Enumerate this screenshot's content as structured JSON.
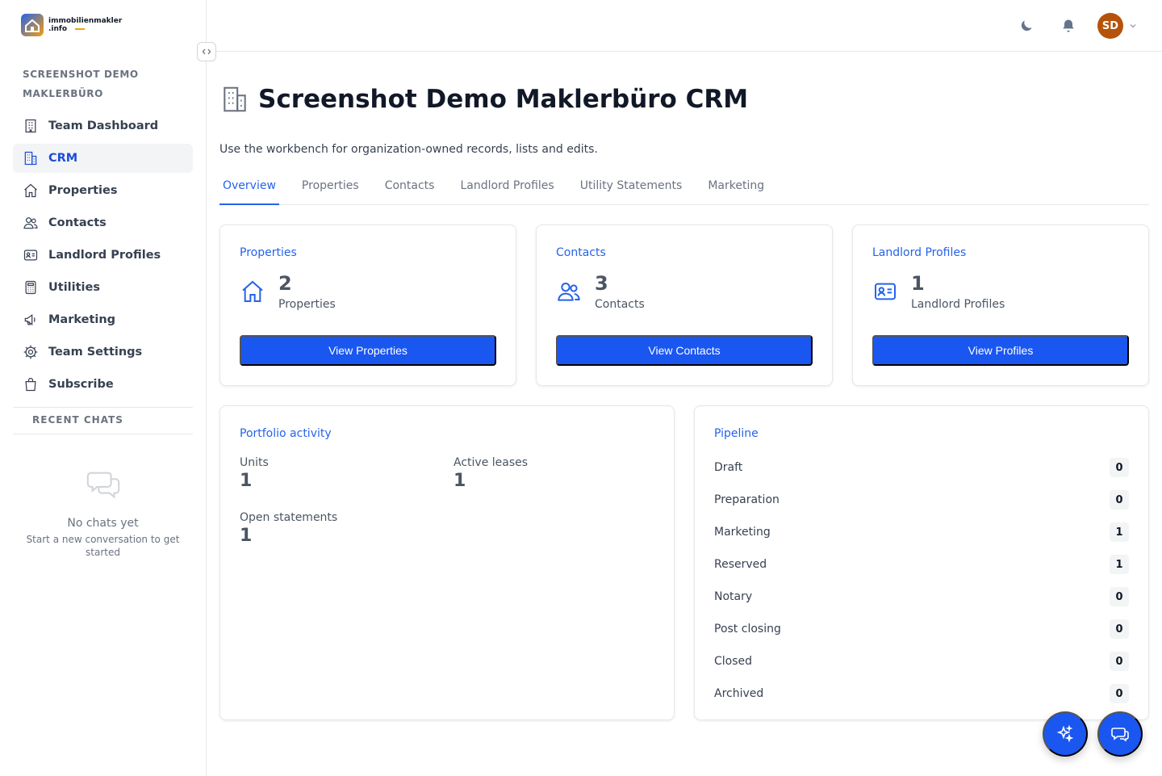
{
  "brand": {
    "line1": "immobilienmakler",
    "line2": ".info"
  },
  "sidebar": {
    "org_name": "SCREENSHOT DEMO MAKLERBÜRO",
    "items": [
      {
        "label": "Team Dashboard",
        "icon": "building-icon"
      },
      {
        "label": "CRM",
        "icon": "office-icon",
        "active": true
      },
      {
        "label": "Properties",
        "icon": "home-icon"
      },
      {
        "label": "Contacts",
        "icon": "users-icon"
      },
      {
        "label": "Landlord Profiles",
        "icon": "id-card-icon"
      },
      {
        "label": "Utilities",
        "icon": "calculator-icon"
      },
      {
        "label": "Marketing",
        "icon": "megaphone-icon"
      },
      {
        "label": "Team Settings",
        "icon": "cog-icon"
      },
      {
        "label": "Subscribe",
        "icon": "shopping-bag-icon"
      }
    ],
    "recent_chats_title": "RECENT CHATS",
    "no_chats_title": "No chats yet",
    "no_chats_text": "Start a new conversation to get started"
  },
  "header": {
    "avatar_initials": "SD"
  },
  "main": {
    "title": "Screenshot Demo Maklerbüro CRM",
    "subtitle": "Use the workbench for organization-owned records, lists and edits.",
    "tabs": [
      "Overview",
      "Properties",
      "Contacts",
      "Landlord Profiles",
      "Utility Statements",
      "Marketing"
    ],
    "active_tab": "Overview",
    "stats": [
      {
        "label": "Properties",
        "value": "2",
        "sub": "Properties",
        "button": "View Properties",
        "icon": "home-icon"
      },
      {
        "label": "Contacts",
        "value": "3",
        "sub": "Contacts",
        "button": "View Contacts",
        "icon": "users-icon"
      },
      {
        "label": "Landlord Profiles",
        "value": "1",
        "sub": "Landlord Profiles",
        "button": "View Profiles",
        "icon": "id-card-icon"
      }
    ],
    "activity": {
      "title": "Portfolio activity",
      "items": [
        {
          "label": "Units",
          "value": "1"
        },
        {
          "label": "Active leases",
          "value": "1"
        },
        {
          "label": "Open statements",
          "value": "1"
        }
      ]
    },
    "pipeline": {
      "title": "Pipeline",
      "rows": [
        {
          "label": "Draft",
          "count": "0"
        },
        {
          "label": "Preparation",
          "count": "0"
        },
        {
          "label": "Marketing",
          "count": "1"
        },
        {
          "label": "Reserved",
          "count": "1"
        },
        {
          "label": "Notary",
          "count": "0"
        },
        {
          "label": "Post closing",
          "count": "0"
        },
        {
          "label": "Closed",
          "count": "0"
        },
        {
          "label": "Archived",
          "count": "0"
        }
      ]
    }
  },
  "colors": {
    "accent": "#1a56f0",
    "avatar_bg": "#b45309",
    "link": "#2563eb"
  }
}
